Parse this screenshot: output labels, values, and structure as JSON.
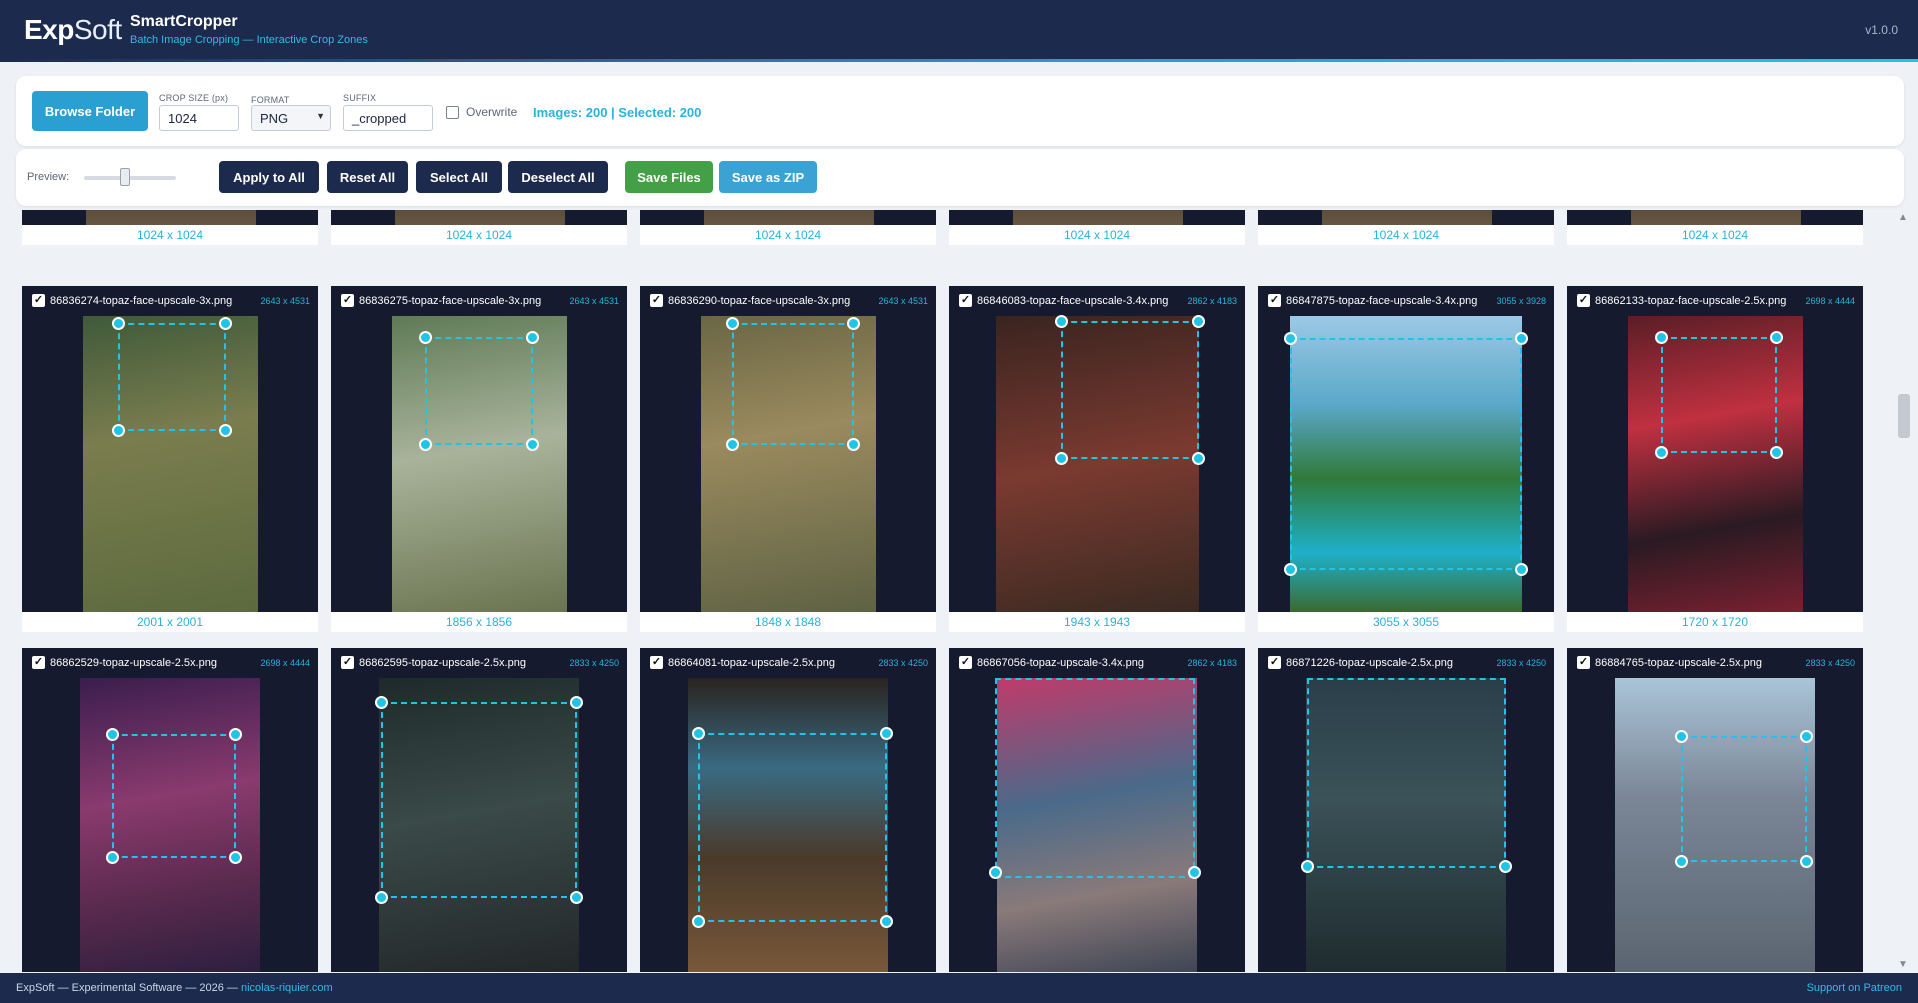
{
  "header": {
    "logo_bold": "Exp",
    "logo_light": "Soft",
    "title": "SmartCropper",
    "subtitle": "Batch Image Cropping — Interactive Crop Zones",
    "version": "v1.0.0"
  },
  "toolbar": {
    "browse_label": "Browse Folder",
    "crop_size_label": "CROP SIZE (px)",
    "crop_size_value": "1024",
    "format_label": "FORMAT",
    "format_value": "PNG",
    "suffix_label": "SUFFIX",
    "suffix_value": "_cropped",
    "overwrite_label": "Overwrite",
    "count_text": "Images: 200 | Selected: 200"
  },
  "actions": {
    "preview_label": "Preview:",
    "preview_level": 0.45,
    "apply_label": "Apply to All",
    "reset_label": "Reset All",
    "select_label": "Select All",
    "deselect_label": "Deselect All",
    "save_label": "Save Files",
    "zip_label": "Save as ZIP"
  },
  "top_row": [
    {
      "caption": "1024 x 1024"
    },
    {
      "caption": "1024 x 1024"
    },
    {
      "caption": "1024 x 1024"
    },
    {
      "caption": "1024 x 1024"
    },
    {
      "caption": "1024 x 1024"
    },
    {
      "caption": "1024 x 1024"
    }
  ],
  "row1": [
    {
      "name": "86836274-topaz-face-upscale-3x.png",
      "dims": "2643 x 4531",
      "caption": "2001 x 2001",
      "color": "#5b6a3a"
    },
    {
      "name": "86836275-topaz-face-upscale-3x.png",
      "dims": "2643 x 4531",
      "caption": "1856 x 1856",
      "color": "#7a8a5e"
    },
    {
      "name": "86836290-topaz-face-upscale-3x.png",
      "dims": "2643 x 4531",
      "caption": "1848 x 1848",
      "color": "#6b7048"
    },
    {
      "name": "86846083-topaz-face-upscale-3.4x.png",
      "dims": "2862 x 4183",
      "caption": "1943 x 1943",
      "color": "#4a2a24"
    },
    {
      "name": "86847875-topaz-face-upscale-3.4x.png",
      "dims": "3055 x 3928",
      "caption": "3055 x 3055",
      "color": "#2e8a8a"
    },
    {
      "name": "86862133-topaz-face-upscale-2.5x.png",
      "dims": "2698 x 4444",
      "caption": "1720 x 1720",
      "color": "#7a1e2a"
    }
  ],
  "row2": [
    {
      "name": "86862529-topaz-upscale-2.5x.png",
      "dims": "2698 x 4444",
      "color": "#5a2a5e"
    },
    {
      "name": "86862595-topaz-upscale-2.5x.png",
      "dims": "2833 x 4250",
      "color": "#2a3a3a"
    },
    {
      "name": "86864081-topaz-upscale-2.5x.png",
      "dims": "2833 x 4250",
      "color": "#3a3228"
    },
    {
      "name": "86867056-topaz-upscale-3.4x.png",
      "dims": "2862 x 4183",
      "color": "#6a3a4e"
    },
    {
      "name": "86871226-topaz-upscale-2.5x.png",
      "dims": "2833 x 4250",
      "color": "#2a3e46"
    },
    {
      "name": "86884765-topaz-upscale-2.5x.png",
      "dims": "2833 x 4250",
      "color": "#5a646e"
    }
  ],
  "footer": {
    "left_text": "ExpSoft — Experimental Software — 2026 —",
    "link_text": "nicolas-riquier.com",
    "right_text": "Support on Patreon"
  }
}
